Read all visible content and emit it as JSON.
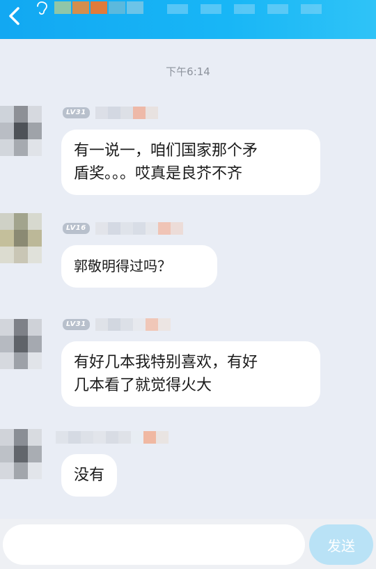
{
  "header": {
    "back_icon": "chevron-left-icon",
    "ear_icon": "ear-icon"
  },
  "timestamp": "下午6:14",
  "messages": [
    {
      "level": "LV31",
      "text": "有一说一，咱们国家那个矛\n盾奖。。。哎真是良芥不齐"
    },
    {
      "level": "LV16",
      "text": "郭敬明得过吗？"
    },
    {
      "level": "LV31",
      "text": "有好几本我特别喜欢，有好\n几本看了就觉得火大"
    },
    {
      "level": "",
      "text": "没有"
    }
  ],
  "input": {
    "placeholder": "",
    "value": ""
  },
  "send_label": "发送",
  "colors": {
    "header": "#18b6f6",
    "background": "#e9edf5",
    "send_button": "#b9e2f6"
  }
}
